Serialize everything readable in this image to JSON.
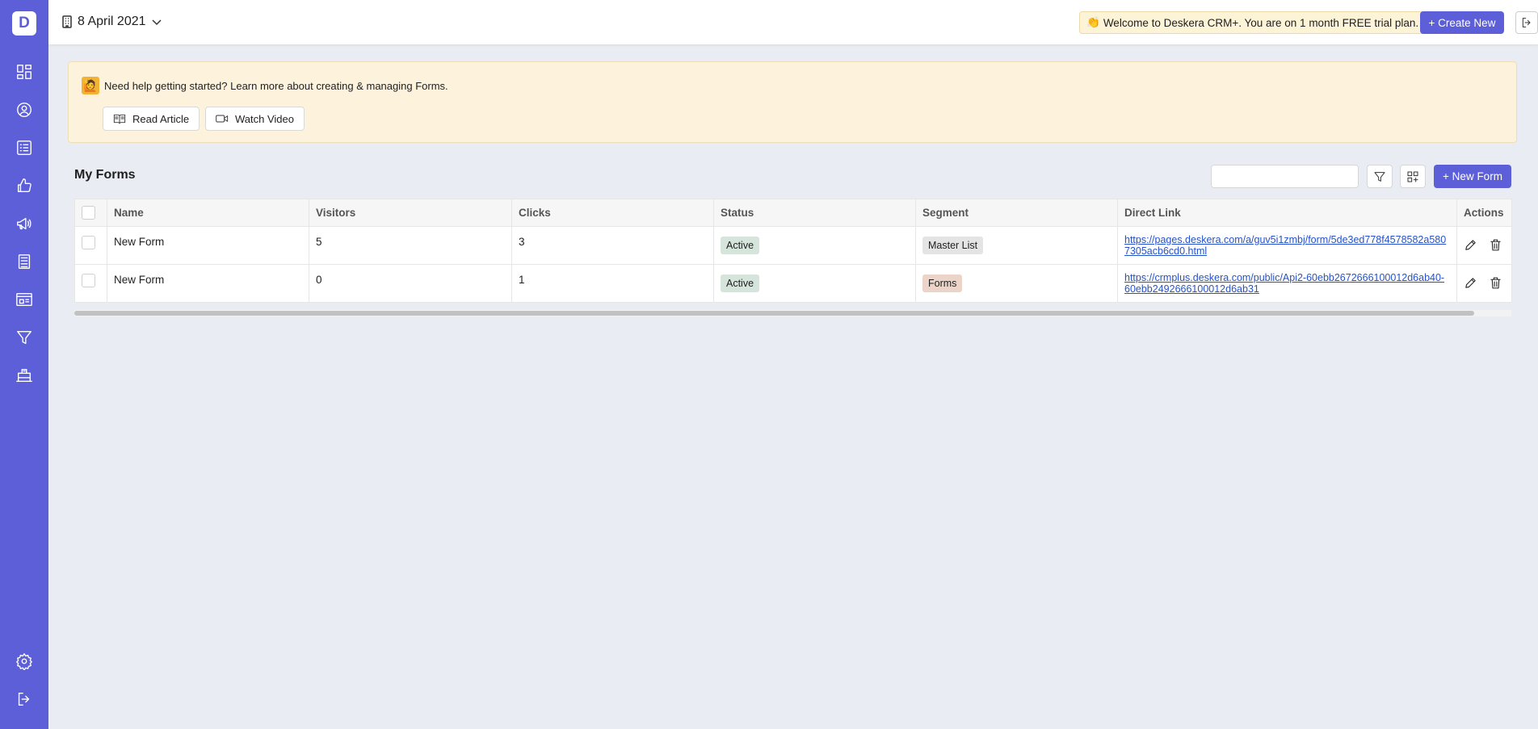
{
  "sidebar": {
    "logo": "D",
    "items": [
      {
        "name": "dashboard-icon"
      },
      {
        "name": "contacts-icon"
      },
      {
        "name": "list-icon"
      },
      {
        "name": "deals-icon"
      },
      {
        "name": "campaign-icon"
      },
      {
        "name": "forms-icon"
      },
      {
        "name": "landing-page-icon"
      },
      {
        "name": "funnel-icon"
      },
      {
        "name": "desk-icon"
      }
    ],
    "bottom": [
      {
        "name": "settings-icon"
      },
      {
        "name": "logout-icon"
      }
    ]
  },
  "header": {
    "date": "8 April 2021",
    "welcome_emoji": "👏",
    "welcome": "Welcome to Deskera CRM+. You are on 1 month FREE trial plan.",
    "create_new": "+ Create New"
  },
  "help": {
    "emoji": "🙋",
    "text": "Need help getting started? Learn more about creating & managing Forms.",
    "read_article": "Read Article",
    "watch_video": "Watch Video"
  },
  "forms": {
    "title": "My Forms",
    "search_placeholder": "",
    "new_form": "+ New Form",
    "columns": [
      "Name",
      "Visitors",
      "Clicks",
      "Status",
      "Segment",
      "Direct Link",
      "Actions"
    ],
    "rows": [
      {
        "name": "New Form",
        "visitors": "5",
        "clicks": "3",
        "status": "Active",
        "segment": "Master List",
        "link": "https://pages.deskera.com/a/guv5i1zmbj/form/5de3ed778f4578582a5807305acb6cd0.html"
      },
      {
        "name": "New Form",
        "visitors": "0",
        "clicks": "1",
        "status": "Active",
        "segment": "Forms",
        "link": "https://crmplus.deskera.com/public/Api2-60ebb2672666100012d6ab40-60ebb2492666100012d6ab31"
      }
    ]
  }
}
